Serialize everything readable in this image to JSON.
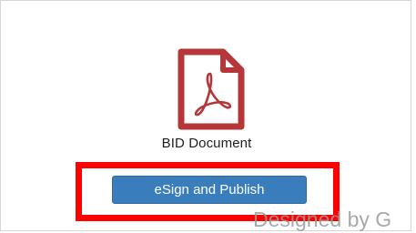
{
  "document": {
    "title": "BID Document",
    "icon": "pdf-document-icon"
  },
  "actions": {
    "esign_publish_label": "eSign and Publish"
  },
  "watermark": {
    "text": "Designed by G"
  },
  "colors": {
    "icon_red": "#b5373a",
    "button_blue": "#3a7dbd",
    "highlight_red": "#ff0000",
    "watermark_gray": "#9a9a9a"
  }
}
